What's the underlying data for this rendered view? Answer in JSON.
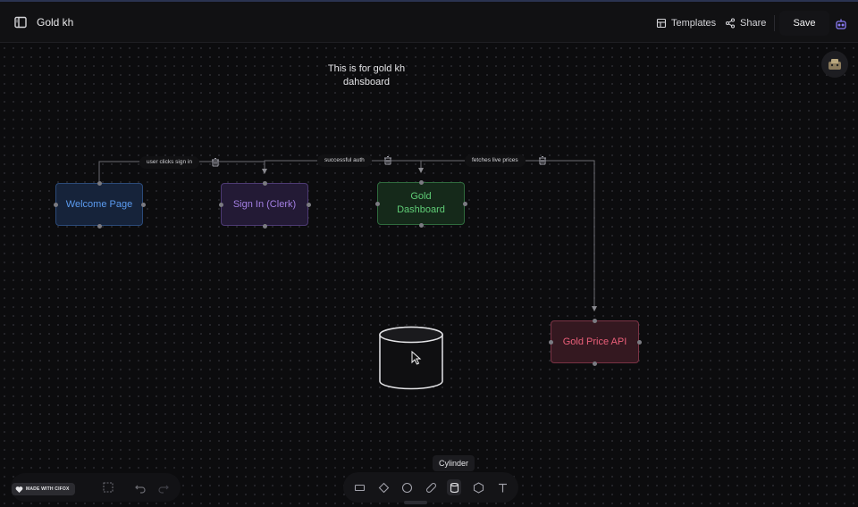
{
  "app": {
    "title": "Gold kh"
  },
  "toolbar": {
    "templates_label": "Templates",
    "share_label": "Share",
    "save_label": "Save"
  },
  "canvas": {
    "text_note": {
      "line1": "This is for gold kh",
      "line2": "dahsboard"
    },
    "nodes": {
      "welcome": "Welcome Page",
      "signin": "Sign In (Clerk)",
      "dashboard_line1": "Gold",
      "dashboard_line2": "Dashboard",
      "api": "Gold Price API"
    },
    "edges": {
      "e1": "user clicks sign in",
      "e2": "successful auth",
      "e3": "fetches live prices"
    }
  },
  "bottom": {
    "badge": "MADE WITH CIFOX",
    "tooltip": "Cylinder"
  },
  "colors": {
    "welcome": "#5b9bf0",
    "signin": "#a37fe3",
    "dashboard": "#5fcc76",
    "api": "#ea5f79"
  },
  "icons": {
    "sidebar": "sidebar-icon",
    "templates": "layout-icon",
    "share": "share-icon",
    "robot": "robot-icon",
    "trash": "trash-icon",
    "cursor": "cursor-icon"
  }
}
